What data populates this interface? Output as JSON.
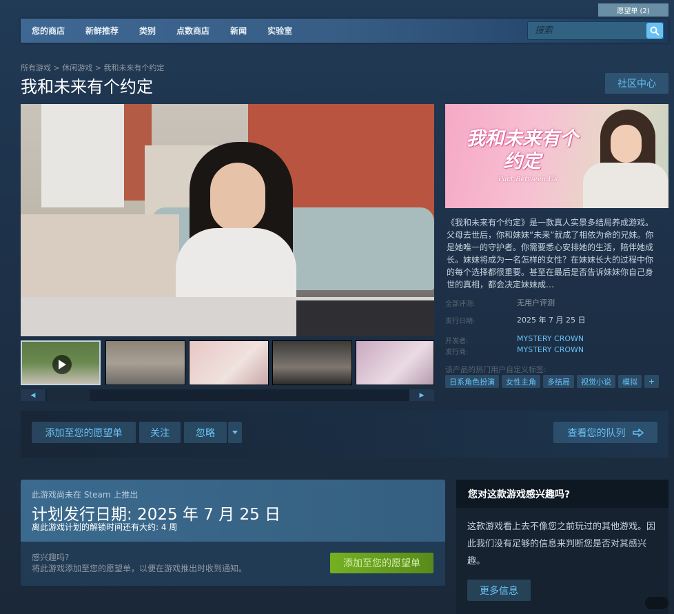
{
  "header": {
    "wishlist_label": "愿望单 (2)"
  },
  "nav": {
    "items": [
      "您的商店",
      "新鲜推荐",
      "类别",
      "点数商店",
      "新闻",
      "实验室"
    ],
    "search_placeholder": "搜索"
  },
  "breadcrumb": [
    "所有游戏",
    "休闲游戏",
    "我和未来有个约定"
  ],
  "breadcrumb_sep": ">",
  "page_title": "我和未来有个约定",
  "community_hub_label": "社区中心",
  "capsule": {
    "title": "我和未来有个约定",
    "subtitle": "Pact Between Us"
  },
  "description": "《我和未来有个约定》是一款真人实景多结局养成游戏。父母去世后，你和妹妹“未来”就成了相依为命的兄妹。你是她唯一的守护者。你需要悉心安排她的生活，陪伴她成长。妹妹将成为一名怎样的女性？在妹妹长大的过程中你的每个选择都很重要。甚至在最后是否告诉妹妹你自己身世的真相，都会决定妹妹成…",
  "info": {
    "reviews_label": "全部评测:",
    "reviews_value": "无用户评测",
    "release_label": "发行日期:",
    "release_value": "2025 年 7 月 25 日",
    "developer_label": "开发者:",
    "developer_value": "MYSTERY CROWN",
    "publisher_label": "发行商:",
    "publisher_value": "MYSTERY CROWN"
  },
  "tags_label": "该产品的热门用户自定义标签:",
  "tags": [
    "日系角色扮演",
    "女性主角",
    "多结局",
    "视觉小说",
    "模拟",
    "+"
  ],
  "actions": {
    "wishlist": "添加至您的愿望单",
    "follow": "关注",
    "ignore": "忽略",
    "queue": "查看您的队列"
  },
  "purchase": {
    "not_released": "此游戏尚未在 Steam 上推出",
    "planned_date": "计划发行日期: 2025 年 7 月 25 日",
    "time_left": "离此游戏计划的解锁时间还有大约:  4 周",
    "interested_q": "感兴趣吗?",
    "interested_hint": "将此游戏添加至您的愿望单，以便在游戏推出时收到通知。",
    "wishlist_btn": "添加至您的愿望单"
  },
  "interest_box": {
    "heading": "您对这款游戏感兴趣吗?",
    "body": "这款游戏看上去不像您之前玩过的其他游戏。因此我们没有足够的信息来判断您是否对其感兴趣。",
    "more_btn": "更多信息"
  },
  "watermark": "小红书",
  "colors": {
    "accent": "#67c1f5",
    "background": "#1b2838",
    "green": "#75b022"
  },
  "icons": [
    "search-icon",
    "play-icon",
    "dropdown-arrow-icon",
    "arrow-right-icon",
    "scroll-left-icon",
    "scroll-right-icon"
  ]
}
